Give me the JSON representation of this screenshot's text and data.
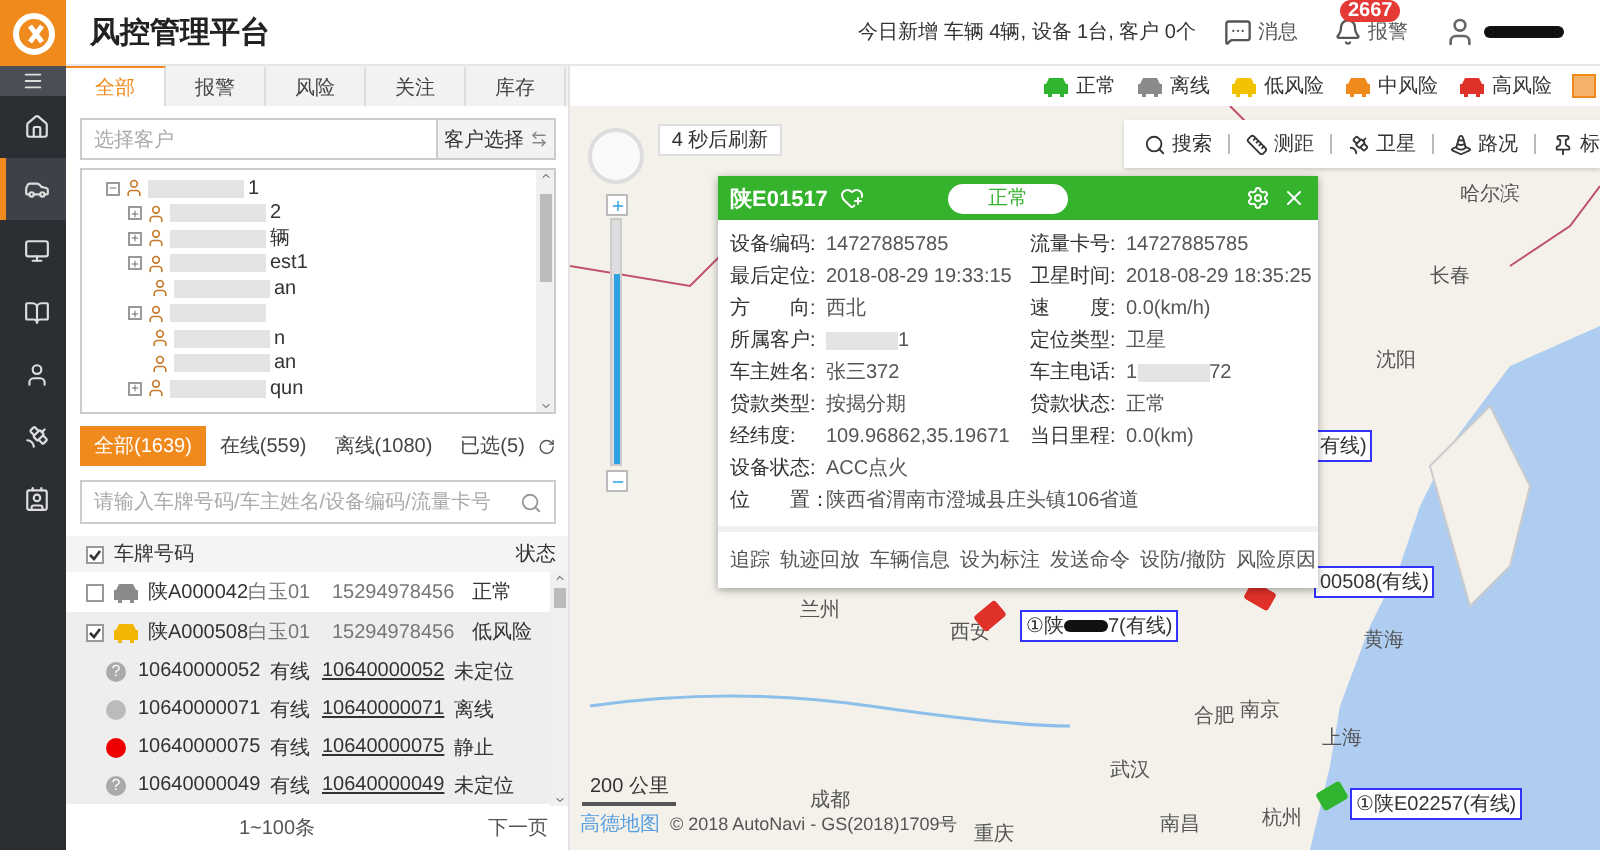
{
  "header": {
    "title": "风控管理平台",
    "today": "今日新增 车辆 4辆, 设备 1台, 客户 0个",
    "messages": "消息",
    "alarm_badge": "2667",
    "alarm": "报警"
  },
  "sidebar": {
    "items": [
      {
        "selected": false
      },
      {
        "selected": true
      },
      {
        "selected": false
      },
      {
        "selected": false
      },
      {
        "selected": false
      },
      {
        "selected": false
      },
      {
        "selected": false
      }
    ]
  },
  "tabs": [
    {
      "label": "全部",
      "selected": true
    },
    {
      "label": "报警",
      "selected": false
    },
    {
      "label": "风险",
      "selected": false
    },
    {
      "label": "关注",
      "selected": false
    },
    {
      "label": "库存",
      "selected": false
    }
  ],
  "customer": {
    "placeholder": "选择客户",
    "button": "客户选择"
  },
  "tree": [
    {
      "text": "1",
      "expanded": true,
      "children": [
        {
          "text": "2",
          "expanded": false
        },
        {
          "text": "辆",
          "expanded": false
        },
        {
          "text": "est1",
          "expanded": false
        },
        {
          "text": "an"
        },
        {
          "expanded": false
        },
        {
          "text": "n"
        },
        {
          "text": "an"
        },
        {
          "text": "qun",
          "expanded": false
        }
      ]
    }
  ],
  "filters": [
    {
      "label": "全部(1639)",
      "selected": true
    },
    {
      "label": "在线(559)",
      "selected": false
    },
    {
      "label": "离线(1080)",
      "selected": false
    },
    {
      "label": "已选(5)",
      "selected": false
    }
  ],
  "vehicle_search": {
    "placeholder": "请输入车牌号码/车主姓名/设备编码/流量卡号"
  },
  "table": {
    "header_checked": true,
    "columns": [
      "车牌号码",
      "状态"
    ],
    "rows": [
      {
        "kind": "vehicle",
        "checked": false,
        "selected": false,
        "color": "#8a8a8a",
        "plate": "陕A000042",
        "owner": "白玉01",
        "phone": "15294978456",
        "status": "正常"
      },
      {
        "kind": "vehicle",
        "checked": true,
        "selected": true,
        "color": "#f2b705",
        "plate": "陕A000508",
        "owner": "白玉01",
        "phone": "15294978456",
        "status": "低风险"
      },
      {
        "kind": "device",
        "color": "#aaaaaa",
        "symbol": "?",
        "device": "10640000052",
        "line": "有线",
        "card": "10640000052",
        "status": "未定位"
      },
      {
        "kind": "device",
        "color": "#bbbbbb",
        "device": "10640000071",
        "line": "有线",
        "card": "10640000071",
        "status": "离线"
      },
      {
        "kind": "device",
        "color": "#ee0000",
        "device": "10640000075",
        "line": "有线",
        "card": "10640000075",
        "status": "静止"
      },
      {
        "kind": "device",
        "color": "#aaaaaa",
        "symbol": "?",
        "device": "10640000049",
        "line": "有线",
        "card": "10640000049",
        "status": "未定位"
      }
    ],
    "range": "1~100条",
    "next": "下一页"
  },
  "legend": [
    {
      "label": "正常",
      "color": "#2fb52f"
    },
    {
      "label": "离线",
      "color": "#8a8a8a"
    },
    {
      "label": "低风险",
      "color": "#f2c200"
    },
    {
      "label": "中风险",
      "color": "#f08a1c"
    },
    {
      "label": "高风险",
      "color": "#e0302a"
    }
  ],
  "map": {
    "refresh": "4 秒后刷新",
    "tools": [
      "搜索",
      "测距",
      "卫星",
      "路况",
      "标"
    ],
    "zoom": {
      "level": 0.78
    },
    "cities": [
      "哈尔滨",
      "长春",
      "沈阳",
      "兰州",
      "西安",
      "合肥",
      "南京",
      "上海",
      "武汉",
      "成都",
      "杭州",
      "南昌",
      "黄海",
      "重庆"
    ],
    "vehicles": [
      {
        "text": "有线)"
      },
      {
        "text": "00508(有线)",
        "color": "#e0302a"
      },
      {
        "text": "①陕",
        "tail": "7(有线)",
        "color": "#e0302a"
      },
      {
        "text": "①陕E02257(有线)",
        "color": "#2fb52f"
      }
    ],
    "scale": "200 公里",
    "brand": "高德地图",
    "copyright": "© 2018 AutoNavi - GS(2018)1709号"
  },
  "popup": {
    "plate": "陕E01517",
    "status": "正常",
    "fields": [
      {
        "kind": "pair",
        "label": "设备编码:",
        "value": "14727885785"
      },
      {
        "kind": "pair",
        "label": "流量卡号:",
        "value": "14727885785"
      },
      {
        "kind": "pair",
        "label": "最后定位:",
        "value": "2018-08-29 19:33:15"
      },
      {
        "kind": "pair",
        "label": "卫星时间:",
        "value": "2018-08-29 18:35:25"
      },
      {
        "kind": "pair",
        "label": "方　　向:",
        "value": "西北"
      },
      {
        "kind": "pair",
        "label": "速　　度:",
        "value": "0.0(km/h)"
      },
      {
        "kind": "redacted",
        "label": "所属客户:",
        "suffix": "1"
      },
      {
        "kind": "pair",
        "label": "定位类型:",
        "value": "卫星"
      },
      {
        "kind": "pair",
        "label": "车主姓名:",
        "value": "张三372"
      },
      {
        "kind": "redacted",
        "label": "车主电话:",
        "prefix": "1",
        "suffix": "72"
      },
      {
        "kind": "pair",
        "label": "贷款类型:",
        "value": "按揭分期"
      },
      {
        "kind": "pair",
        "label": "贷款状态:",
        "value": "正常"
      },
      {
        "kind": "pair",
        "label": "经纬度:",
        "value": "109.96862,35.19671"
      },
      {
        "kind": "pair",
        "label": "当日里程:",
        "value": "0.0(km)"
      },
      {
        "kind": "wide",
        "label": "设备状态:",
        "value": "ACC点火"
      },
      {
        "kind": "wide",
        "label": "位　　置：",
        "value": "陕西省渭南市澄城县庄头镇106省道"
      }
    ],
    "actions": [
      "追踪",
      "轨迹回放",
      "车辆信息",
      "设为标注",
      "发送命令",
      "设防/撤防",
      "风险原因"
    ]
  }
}
